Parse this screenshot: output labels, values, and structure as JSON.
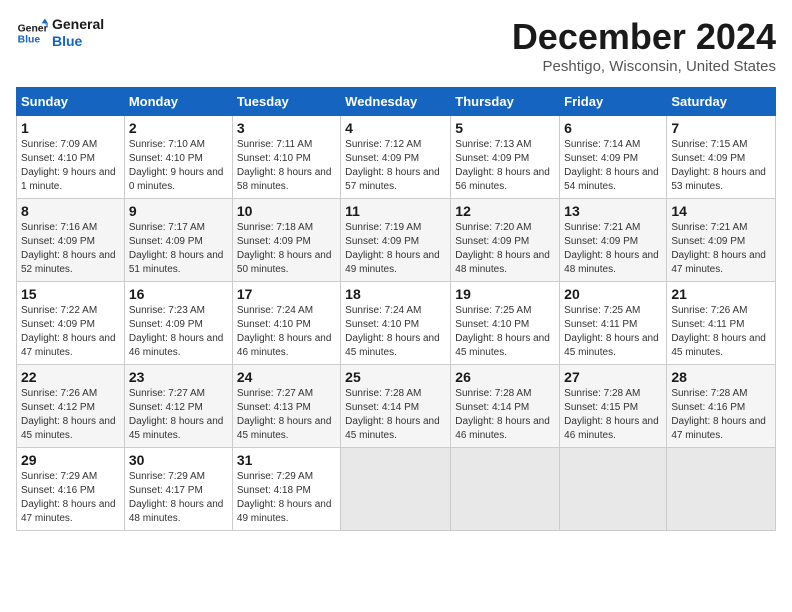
{
  "logo": {
    "line1": "General",
    "line2": "Blue"
  },
  "title": "December 2024",
  "subtitle": "Peshtigo, Wisconsin, United States",
  "columns": [
    "Sunday",
    "Monday",
    "Tuesday",
    "Wednesday",
    "Thursday",
    "Friday",
    "Saturday"
  ],
  "weeks": [
    [
      {
        "day": "1",
        "sunrise": "7:09 AM",
        "sunset": "4:10 PM",
        "daylight": "9 hours and 1 minute."
      },
      {
        "day": "2",
        "sunrise": "7:10 AM",
        "sunset": "4:10 PM",
        "daylight": "9 hours and 0 minutes."
      },
      {
        "day": "3",
        "sunrise": "7:11 AM",
        "sunset": "4:10 PM",
        "daylight": "8 hours and 58 minutes."
      },
      {
        "day": "4",
        "sunrise": "7:12 AM",
        "sunset": "4:09 PM",
        "daylight": "8 hours and 57 minutes."
      },
      {
        "day": "5",
        "sunrise": "7:13 AM",
        "sunset": "4:09 PM",
        "daylight": "8 hours and 56 minutes."
      },
      {
        "day": "6",
        "sunrise": "7:14 AM",
        "sunset": "4:09 PM",
        "daylight": "8 hours and 54 minutes."
      },
      {
        "day": "7",
        "sunrise": "7:15 AM",
        "sunset": "4:09 PM",
        "daylight": "8 hours and 53 minutes."
      }
    ],
    [
      {
        "day": "8",
        "sunrise": "7:16 AM",
        "sunset": "4:09 PM",
        "daylight": "8 hours and 52 minutes."
      },
      {
        "day": "9",
        "sunrise": "7:17 AM",
        "sunset": "4:09 PM",
        "daylight": "8 hours and 51 minutes."
      },
      {
        "day": "10",
        "sunrise": "7:18 AM",
        "sunset": "4:09 PM",
        "daylight": "8 hours and 50 minutes."
      },
      {
        "day": "11",
        "sunrise": "7:19 AM",
        "sunset": "4:09 PM",
        "daylight": "8 hours and 49 minutes."
      },
      {
        "day": "12",
        "sunrise": "7:20 AM",
        "sunset": "4:09 PM",
        "daylight": "8 hours and 48 minutes."
      },
      {
        "day": "13",
        "sunrise": "7:21 AM",
        "sunset": "4:09 PM",
        "daylight": "8 hours and 48 minutes."
      },
      {
        "day": "14",
        "sunrise": "7:21 AM",
        "sunset": "4:09 PM",
        "daylight": "8 hours and 47 minutes."
      }
    ],
    [
      {
        "day": "15",
        "sunrise": "7:22 AM",
        "sunset": "4:09 PM",
        "daylight": "8 hours and 47 minutes."
      },
      {
        "day": "16",
        "sunrise": "7:23 AM",
        "sunset": "4:09 PM",
        "daylight": "8 hours and 46 minutes."
      },
      {
        "day": "17",
        "sunrise": "7:24 AM",
        "sunset": "4:10 PM",
        "daylight": "8 hours and 46 minutes."
      },
      {
        "day": "18",
        "sunrise": "7:24 AM",
        "sunset": "4:10 PM",
        "daylight": "8 hours and 45 minutes."
      },
      {
        "day": "19",
        "sunrise": "7:25 AM",
        "sunset": "4:10 PM",
        "daylight": "8 hours and 45 minutes."
      },
      {
        "day": "20",
        "sunrise": "7:25 AM",
        "sunset": "4:11 PM",
        "daylight": "8 hours and 45 minutes."
      },
      {
        "day": "21",
        "sunrise": "7:26 AM",
        "sunset": "4:11 PM",
        "daylight": "8 hours and 45 minutes."
      }
    ],
    [
      {
        "day": "22",
        "sunrise": "7:26 AM",
        "sunset": "4:12 PM",
        "daylight": "8 hours and 45 minutes."
      },
      {
        "day": "23",
        "sunrise": "7:27 AM",
        "sunset": "4:12 PM",
        "daylight": "8 hours and 45 minutes."
      },
      {
        "day": "24",
        "sunrise": "7:27 AM",
        "sunset": "4:13 PM",
        "daylight": "8 hours and 45 minutes."
      },
      {
        "day": "25",
        "sunrise": "7:28 AM",
        "sunset": "4:14 PM",
        "daylight": "8 hours and 45 minutes."
      },
      {
        "day": "26",
        "sunrise": "7:28 AM",
        "sunset": "4:14 PM",
        "daylight": "8 hours and 46 minutes."
      },
      {
        "day": "27",
        "sunrise": "7:28 AM",
        "sunset": "4:15 PM",
        "daylight": "8 hours and 46 minutes."
      },
      {
        "day": "28",
        "sunrise": "7:28 AM",
        "sunset": "4:16 PM",
        "daylight": "8 hours and 47 minutes."
      }
    ],
    [
      {
        "day": "29",
        "sunrise": "7:29 AM",
        "sunset": "4:16 PM",
        "daylight": "8 hours and 47 minutes."
      },
      {
        "day": "30",
        "sunrise": "7:29 AM",
        "sunset": "4:17 PM",
        "daylight": "8 hours and 48 minutes."
      },
      {
        "day": "31",
        "sunrise": "7:29 AM",
        "sunset": "4:18 PM",
        "daylight": "8 hours and 49 minutes."
      },
      null,
      null,
      null,
      null
    ]
  ],
  "labels": {
    "sunrise": "Sunrise:",
    "sunset": "Sunset:",
    "daylight": "Daylight:"
  }
}
